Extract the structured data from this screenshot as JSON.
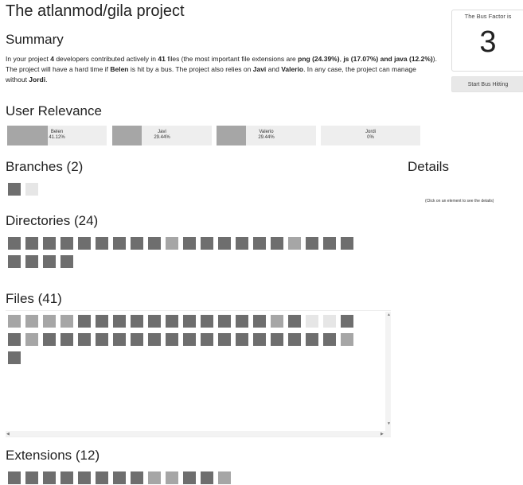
{
  "title": "The atlanmod/gila project",
  "summary": {
    "heading": "Summary",
    "p1": "In your project ",
    "devs": "4",
    "p2": " developers contributed actively in ",
    "files": "41",
    "p3": " files (the most important file extensions are ",
    "ext1": "png (24.39%)",
    "p4": ", ",
    "ext2": "js (17.07%) and java (12.2%)",
    "p5": "). The project will have a hard time if ",
    "critical": "Belen",
    "p6": " is hit by a bus. The project also relies on ",
    "also1": "Javi",
    "p7": " and ",
    "also2": "Valerio",
    "p8": ". In any case, the project can manage without ",
    "safe": "Jordi",
    "p9": "."
  },
  "bus_factor": {
    "label": "The Bus Factor is",
    "value": "3",
    "button": "Start Bus Hitting"
  },
  "user_relevance": {
    "heading": "User Relevance",
    "users": [
      {
        "name": "Belen",
        "pct_text": "41.12%",
        "fraction": 0.4112
      },
      {
        "name": "Javi",
        "pct_text": "29.44%",
        "fraction": 0.2944
      },
      {
        "name": "Valerio",
        "pct_text": "29.44%",
        "fraction": 0.2944
      },
      {
        "name": "Jordi",
        "pct_text": "0%",
        "fraction": 0
      }
    ]
  },
  "branches": {
    "heading": "Branches (2)",
    "tiles": [
      "dark",
      "light"
    ]
  },
  "details": {
    "heading": "Details",
    "hint": "(Click on an element to see the details)"
  },
  "directories": {
    "heading": "Directories (24)",
    "tiles": [
      "dark",
      "dark",
      "dark",
      "dark",
      "dark",
      "dark",
      "dark",
      "dark",
      "dark",
      "mid",
      "dark",
      "dark",
      "dark",
      "dark",
      "dark",
      "dark",
      "mid",
      "dark",
      "dark",
      "dark",
      "dark",
      "dark",
      "dark",
      "dark"
    ]
  },
  "files": {
    "heading": "Files (41)",
    "tiles": [
      "mid",
      "mid",
      "mid",
      "mid",
      "dark",
      "dark",
      "dark",
      "dark",
      "dark",
      "dark",
      "dark",
      "dark",
      "dark",
      "dark",
      "dark",
      "mid",
      "dark",
      "light",
      "light",
      "dark",
      "dark",
      "mid",
      "dark",
      "dark",
      "dark",
      "dark",
      "dark",
      "dark",
      "dark",
      "dark",
      "dark",
      "dark",
      "dark",
      "dark",
      "dark",
      "dark",
      "dark",
      "dark",
      "dark",
      "mid",
      "dark"
    ]
  },
  "extensions": {
    "heading": "Extensions (12)",
    "tiles": [
      "dark",
      "dark",
      "dark",
      "dark",
      "dark",
      "dark",
      "dark",
      "dark",
      "mid",
      "mid",
      "dark",
      "dark",
      "mid"
    ]
  }
}
